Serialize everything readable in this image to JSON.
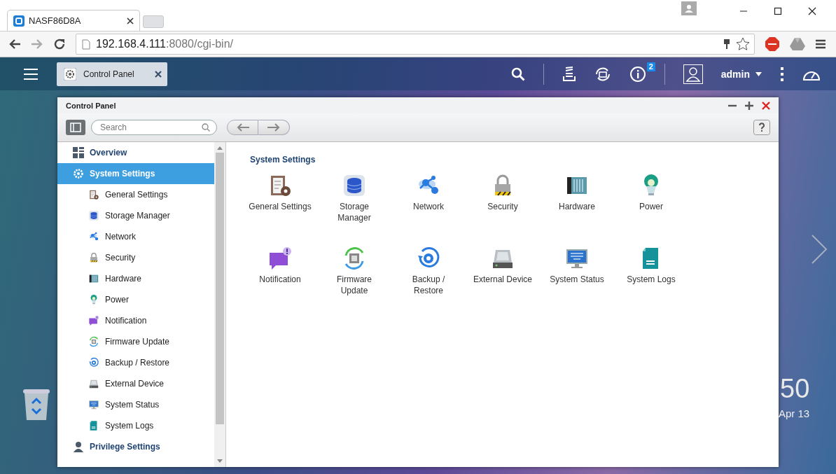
{
  "browser": {
    "tab_title": "NASF86D8A",
    "url_host": "192.168.4.111",
    "url_path": ":8080/cgi-bin/"
  },
  "header": {
    "app_tab": "Control Panel",
    "notification_count": "2",
    "user": "admin"
  },
  "window": {
    "title": "Control Panel",
    "search": {
      "placeholder": "Search"
    }
  },
  "sidebar": {
    "items": [
      {
        "label": "Overview",
        "selected": false
      },
      {
        "label": "System Settings",
        "selected": true,
        "children": [
          {
            "label": "General Settings",
            "selected": false
          },
          {
            "label": "Storage Manager",
            "selected": false
          },
          {
            "label": "Network",
            "selected": false
          },
          {
            "label": "Security",
            "selected": false
          },
          {
            "label": "Hardware",
            "selected": false
          },
          {
            "label": "Power",
            "selected": false
          },
          {
            "label": "Notification",
            "selected": false
          },
          {
            "label": "Firmware Update",
            "selected": false
          },
          {
            "label": "Backup / Restore",
            "selected": false
          },
          {
            "label": "External Device",
            "selected": false
          },
          {
            "label": "System Status",
            "selected": false
          },
          {
            "label": "System Logs",
            "selected": false
          }
        ]
      },
      {
        "label": "Privilege Settings",
        "selected": false
      }
    ]
  },
  "main": {
    "section_title": "System Settings",
    "tiles": [
      {
        "label": "General Settings"
      },
      {
        "label": "Storage\nManager"
      },
      {
        "label": "Network"
      },
      {
        "label": "Security"
      },
      {
        "label": "Hardware"
      },
      {
        "label": "Power"
      },
      {
        "label": "Notification"
      },
      {
        "label": "Firmware\nUpdate"
      },
      {
        "label": "Backup /\nRestore"
      },
      {
        "label": "External Device"
      },
      {
        "label": "System Status"
      },
      {
        "label": "System Logs"
      }
    ]
  },
  "desktop": {
    "clock": "50",
    "date": "Apr 13"
  }
}
